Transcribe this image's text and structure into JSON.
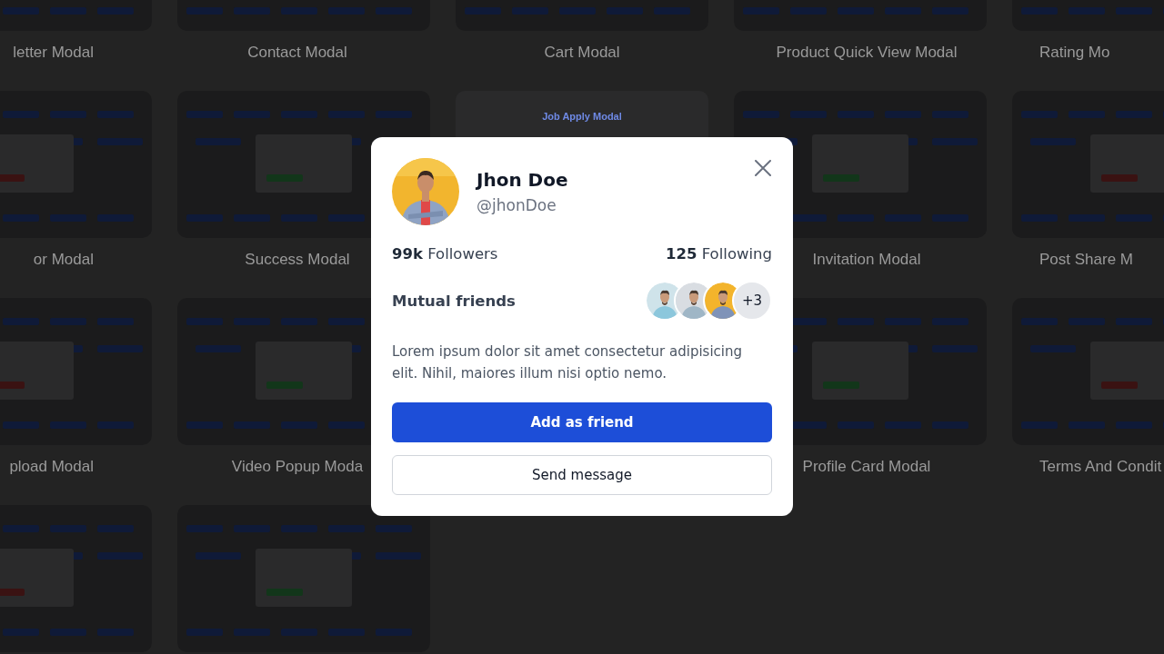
{
  "gallery": [
    {
      "left": [
        {
          "kind": "dark",
          "label": "letter Modal"
        },
        {
          "kind": "dark",
          "label": "Contact Modal"
        }
      ],
      "middle": {
        "kind": "dark",
        "label": "Cart Modal"
      },
      "right": [
        {
          "kind": "dark",
          "label": "Product Quick View Modal"
        },
        {
          "kind": "dark",
          "label": "Rating Mo"
        }
      ]
    },
    {
      "left": [
        {
          "kind": "dark",
          "label": "or Modal"
        },
        {
          "kind": "dark",
          "label": "Success Modal"
        }
      ],
      "middle": {
        "kind": "light",
        "preview_title": "Job Apply Modal"
      },
      "right": [
        {
          "kind": "dark",
          "label": "Invitation Modal"
        },
        {
          "kind": "dark",
          "label": "Post Share M"
        }
      ]
    },
    {
      "left": [
        {
          "kind": "dark",
          "label": "pload Modal"
        },
        {
          "kind": "dark",
          "label": "Video Popup Moda"
        }
      ],
      "right": [
        {
          "kind": "dark",
          "label": "Profile Card Modal"
        },
        {
          "kind": "dark",
          "label": "Terms And Condit"
        }
      ]
    },
    {
      "left": [
        {
          "kind": "dark"
        },
        {
          "kind": "dark"
        }
      ]
    }
  ],
  "profile": {
    "name": "Jhon Doe",
    "handle": "@jhonDoe",
    "followers_count": "99k",
    "followers_label": "Followers",
    "following_count": "125",
    "following_label": "Following",
    "mutual_label": "Mutual friends",
    "mutual_more": "+3",
    "bio": "Lorem ipsum dolor sit amet consectetur adipisicing elit. Nihil, maiores illum nisi optio nemo.",
    "buttons": [
      {
        "label": "Add as friend",
        "kind": "primary"
      },
      {
        "label": "Send message",
        "kind": "secondary"
      }
    ]
  }
}
